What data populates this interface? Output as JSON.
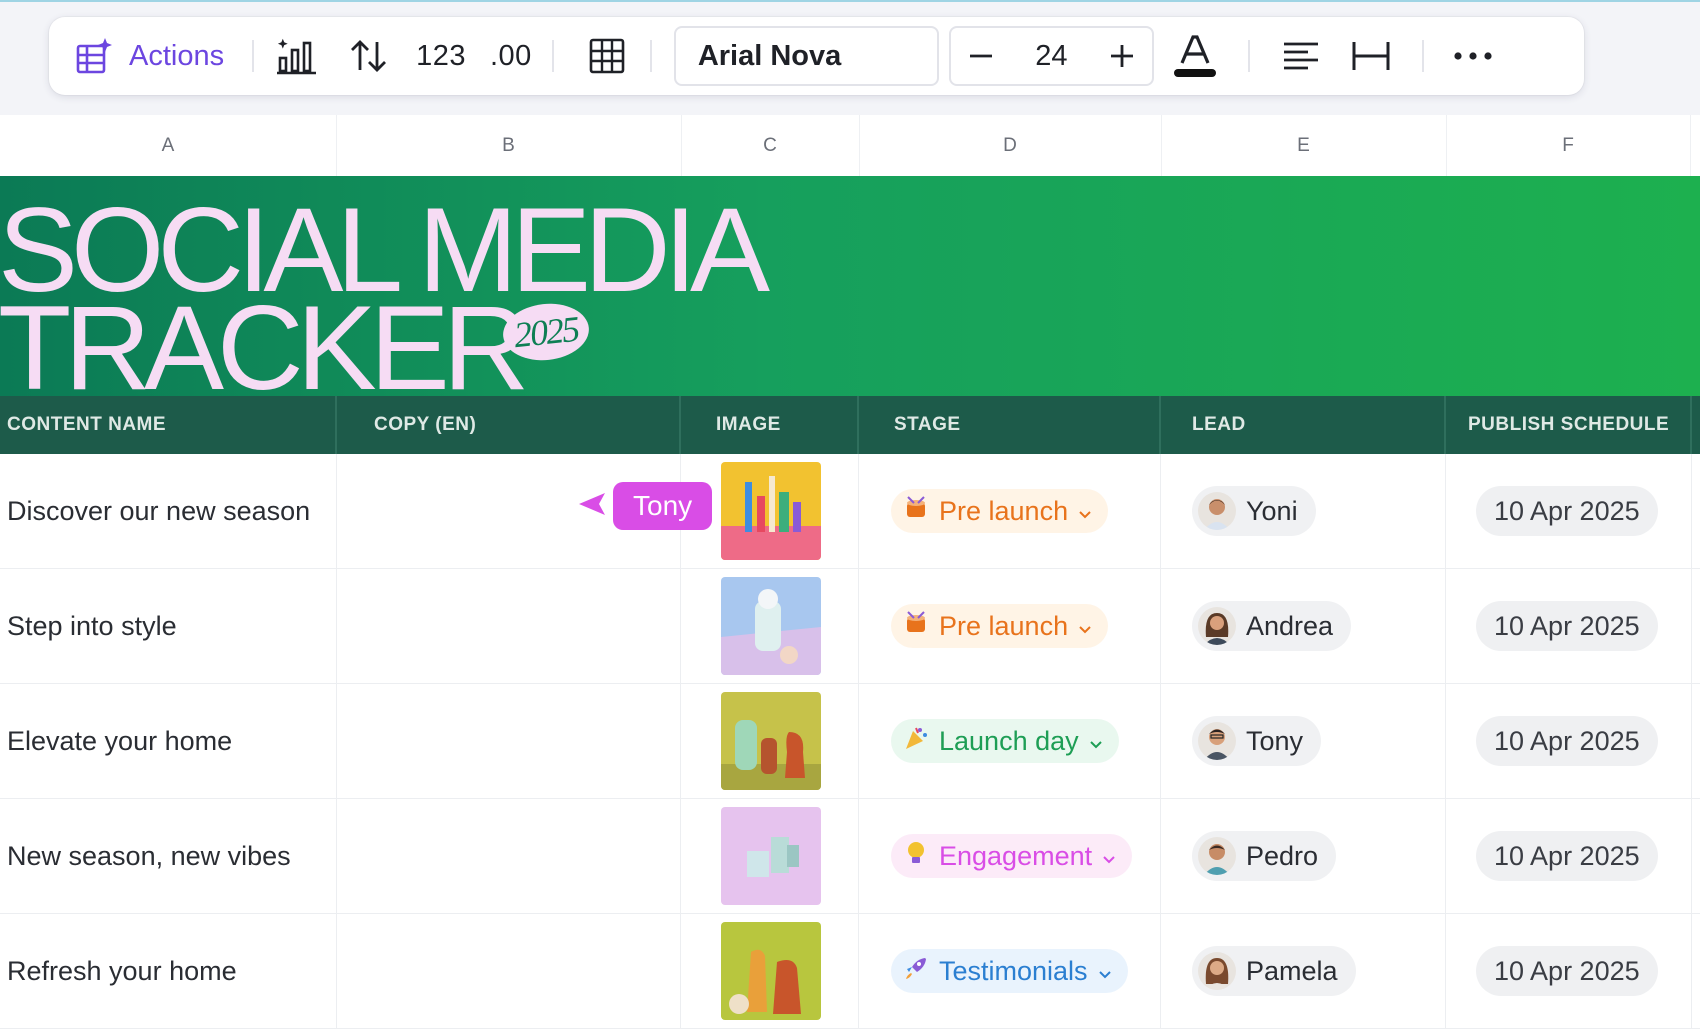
{
  "toolbar": {
    "actions_label": "Actions",
    "number_format_label": "123",
    "decimal_label": ".00",
    "font_name": "Arial Nova",
    "font_size": "24",
    "icons": [
      "actions-sparkle-table-icon",
      "chart-icon",
      "sort-icon",
      "grid-icon",
      "minus-icon",
      "plus-icon",
      "text-color-icon",
      "align-left-icon",
      "column-width-icon",
      "more-icon"
    ],
    "accent_color": "#6c46e0"
  },
  "columns": [
    "A",
    "B",
    "C",
    "D",
    "E",
    "F"
  ],
  "banner": {
    "line1": "SOCIAL MEDIA",
    "line2": "TRACKER",
    "year": "2025",
    "text_color": "#f6dcf4"
  },
  "fields": [
    "CONTENT NAME",
    "COPY (EN)",
    "IMAGE",
    "STAGE",
    "LEAD",
    "PUBLISH SCHEDULE"
  ],
  "rows": [
    {
      "content_name": "Discover our new season",
      "copy": "",
      "stage": "Pre launch",
      "lead": "Yoni",
      "publish": "10 Apr 2025"
    },
    {
      "content_name": "Step into style",
      "copy": "",
      "stage": "Pre launch",
      "lead": "Andrea",
      "publish": "10 Apr 2025"
    },
    {
      "content_name": "Elevate your home",
      "copy": "",
      "stage": "Launch day",
      "lead": "Tony",
      "publish": "10 Apr 2025"
    },
    {
      "content_name": "New season, new vibes",
      "copy": "",
      "stage": "Engagement",
      "lead": "Pedro",
      "publish": "10 Apr 2025"
    },
    {
      "content_name": "Refresh your home",
      "copy": "",
      "stage": "Testimonials",
      "lead": "Pamela",
      "publish": "10 Apr 2025"
    }
  ],
  "stage_colors": {
    "Pre launch": {
      "bg": "#fff4e6",
      "fg": "#e8731c"
    },
    "Launch day": {
      "bg": "#e9f8ef",
      "fg": "#1e9e55"
    },
    "Engagement": {
      "bg": "#fcebf8",
      "fg": "#d94de6"
    },
    "Testimonials": {
      "bg": "#e9f3fd",
      "fg": "#2b7fd1"
    }
  },
  "collaborator_cursor": {
    "name": "Tony",
    "color": "#d94de6"
  }
}
